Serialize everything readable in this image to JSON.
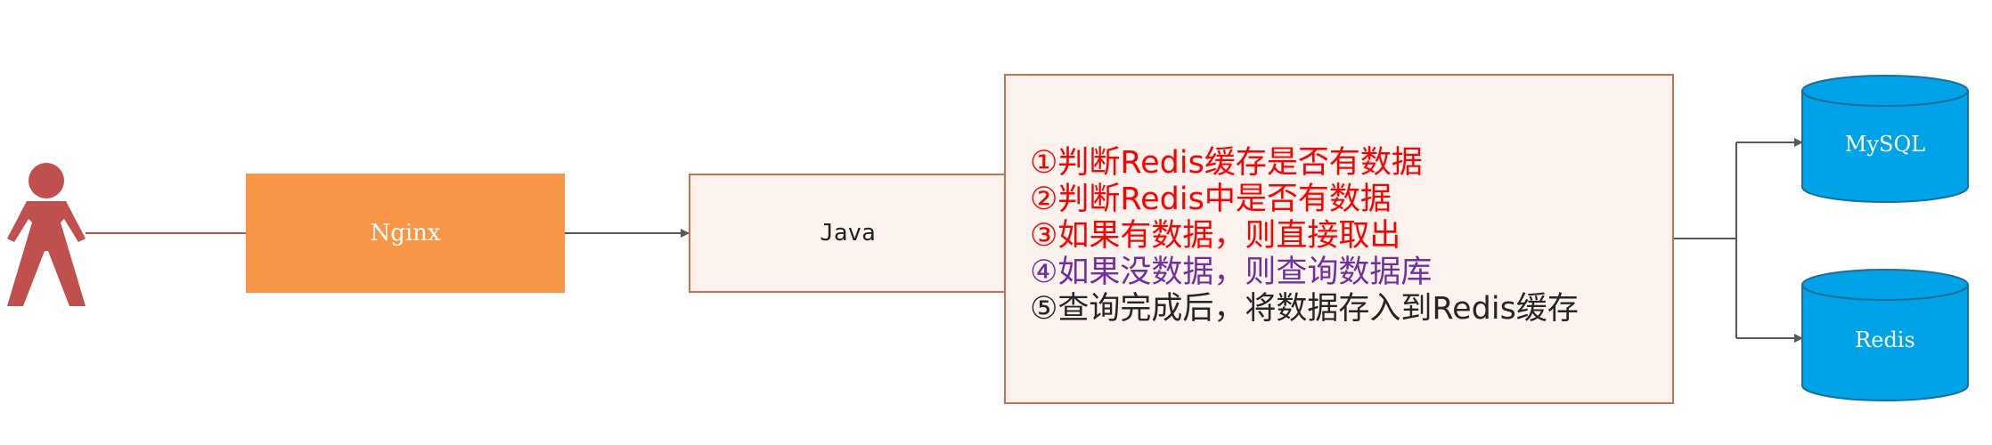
{
  "nodes": {
    "nginx": "Nginx",
    "java": "Java",
    "mysql": "MySQL",
    "redis": "Redis"
  },
  "steps": [
    {
      "text": "①判断Redis缓存是否有数据",
      "color": "#ff0000"
    },
    {
      "text": "②判断Redis中是否有数据",
      "color": "#ff0000"
    },
    {
      "text": "③如果有数据，则直接取出",
      "color": "#ff0000"
    },
    {
      "text": "④如果没数据，则查询数据库",
      "color": "#7030a0"
    },
    {
      "text": "⑤查询完成后，将数据存入到Redis缓存",
      "color": "#262626"
    }
  ],
  "colors": {
    "user": "#c0504d",
    "nginx": "#f79646",
    "box_fill": "#fdf3ee",
    "box_border": "#c9704f",
    "database": "#00a2e8",
    "connector": "#595959"
  },
  "icons": {
    "user": "person-icon",
    "databases": "database-cylinder-icon"
  }
}
